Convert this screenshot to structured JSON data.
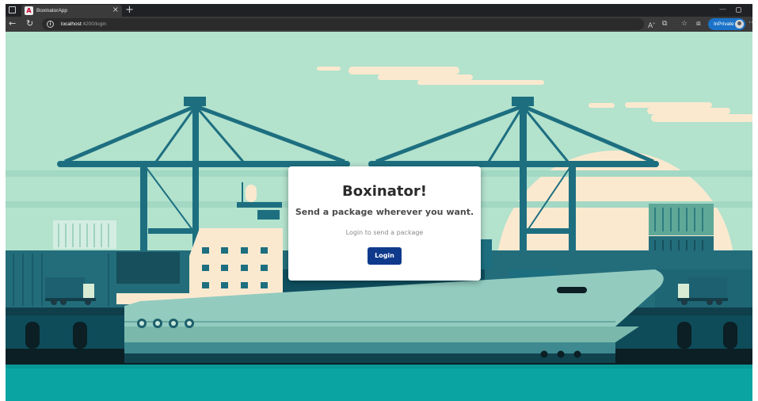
{
  "browser": {
    "tab": {
      "title": "BoxinatorApp",
      "favicon_letter": "A",
      "close_glyph": "×"
    },
    "new_tab_glyph": "+",
    "window": {
      "minimize_glyph": "—"
    },
    "address": {
      "host": "localhost",
      "path": ":4200/login"
    },
    "inprivate_label": "InPrivate",
    "more_glyph": "···",
    "icons": [
      "window-icon",
      "back-arrow-icon",
      "reload-icon",
      "info-icon",
      "read-aloud-icon",
      "extensions-icon",
      "favorites-icon",
      "collections-icon",
      "profile-avatar-icon",
      "more-icon"
    ]
  },
  "login": {
    "title": "Boxinator!",
    "subtitle": "Send a package wherever you want.",
    "hint": "Login to send a package",
    "button_label": "Login"
  },
  "colors": {
    "sky": "#b3e2cd",
    "crane": "#1d6f80",
    "dock": "#0f5161",
    "water": "#0aa5a3",
    "ship_hull": "#93cbbf",
    "login_button": "#0f3a8c"
  }
}
